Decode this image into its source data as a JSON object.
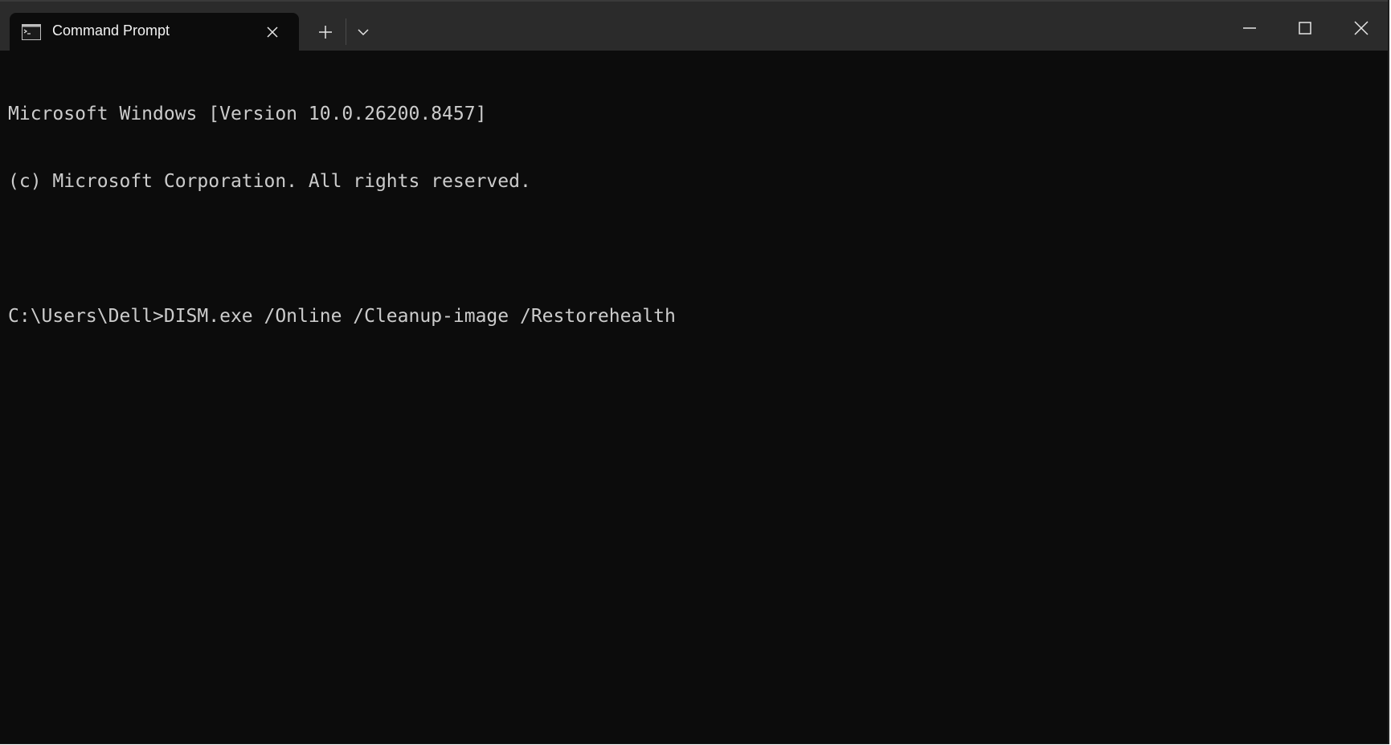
{
  "window": {
    "tab": {
      "title": "Command Prompt",
      "icon": "command-prompt-icon"
    },
    "toolbar": {
      "new_tab_icon": "plus-icon",
      "dropdown_icon": "chevron-down-icon"
    },
    "controls": {
      "minimize_icon": "minimize-icon",
      "maximize_icon": "maximize-icon",
      "close_icon": "close-icon"
    }
  },
  "terminal": {
    "lines": [
      "Microsoft Windows [Version 10.0.26200.8457]",
      "(c) Microsoft Corporation. All rights reserved.",
      "",
      "C:\\Users\\Dell>DISM.exe /Online /Cleanup-image /Restorehealth"
    ]
  },
  "colors": {
    "titlebar_bg": "#2b2b2b",
    "terminal_bg": "#0c0c0c",
    "terminal_text": "#cccccc",
    "tab_text": "#f2f2f2"
  }
}
